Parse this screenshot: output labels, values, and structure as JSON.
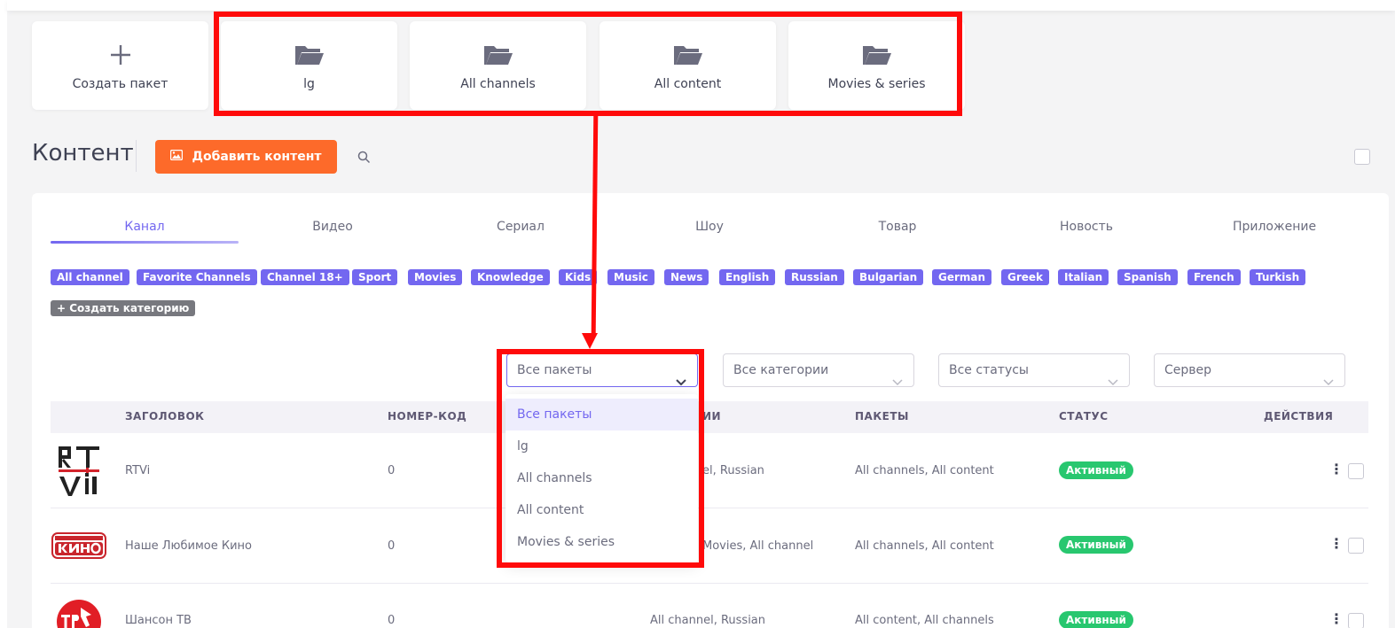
{
  "packages": {
    "create_label": "Создать пакет",
    "items": [
      "lg",
      "All channels",
      "All content",
      "Movies & series"
    ]
  },
  "content": {
    "title": "Контент",
    "add_button": "Добавить контент"
  },
  "tabs": [
    "Канал",
    "Видео",
    "Сериал",
    "Шоу",
    "Товар",
    "Новость",
    "Приложение"
  ],
  "categories": [
    "All channel",
    "Favorite Channels",
    "Channel 18+",
    "Sport",
    "Movies",
    "Knowledge",
    "Kids",
    "Music",
    "News",
    "English",
    "Russian",
    "Bulgarian",
    "German",
    "Greek",
    "Italian",
    "Spanish",
    "French",
    "Turkish"
  ],
  "create_category": "+ Создать категорию",
  "filters": {
    "packages": "Все пакеты",
    "categories": "Все категории",
    "statuses": "Все статусы",
    "server": "Сервер"
  },
  "dropdown_options": [
    "Все пакеты",
    "lg",
    "All channels",
    "All content",
    "Movies & series"
  ],
  "table": {
    "headers": {
      "title": "ЗАГОЛОВОК",
      "code": "НОМЕР-КОД",
      "categories_partial": "ИИ",
      "packages": "ПАКЕТЫ",
      "status": "СТАТУС",
      "actions": "ДЕЙСТВИЯ"
    },
    "rows": [
      {
        "title": "RTVi",
        "code": "0",
        "categories": "el, Russian",
        "packages": "All channels, All content",
        "status": "Активный",
        "logo": "rtvi-logo"
      },
      {
        "title": "Наше Любимое Кино",
        "code": "0",
        "categories": "Movies, All channel",
        "packages": "All channels, All content",
        "status": "Активный",
        "logo": "kino-logo"
      },
      {
        "title": "Шансон ТВ",
        "code": "0",
        "categories": "All channel, Russian",
        "packages": "All content, All channels",
        "status": "Активный",
        "logo": "shanson-logo"
      }
    ]
  },
  "colors": {
    "accent": "#7367f0",
    "orange": "#fd6a2a",
    "success": "#28c76f",
    "annotation": "#ff0a0a"
  }
}
